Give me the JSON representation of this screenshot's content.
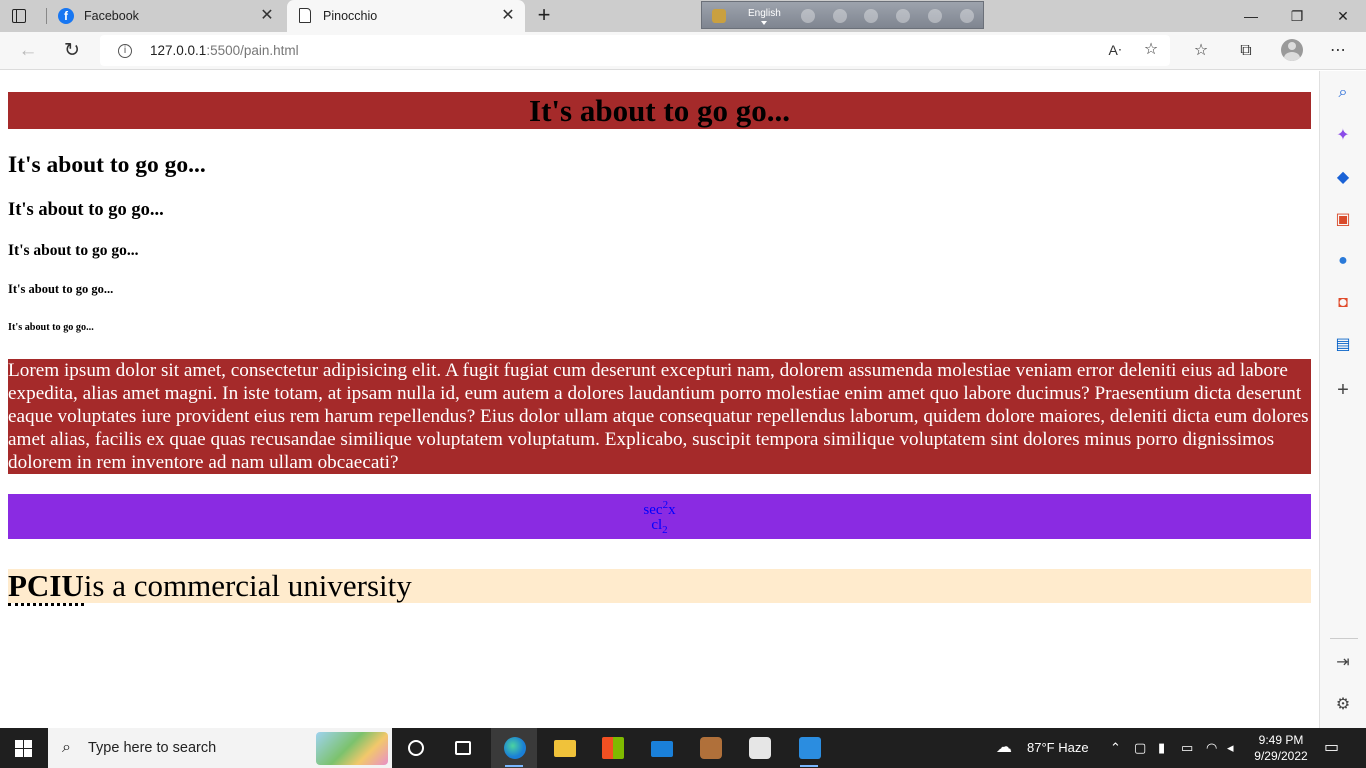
{
  "browser": {
    "tabs": [
      {
        "label": "Facebook",
        "icon": "facebook-icon"
      },
      {
        "label": "Pinocchio",
        "icon": "document-icon"
      }
    ],
    "ime_language": "English",
    "url_host": "127.0.0.1",
    "url_rest": ":5500/pain.html"
  },
  "page": {
    "h1": "It's about to go go...",
    "h2": "It's about to go go...",
    "h3": "It's about to go go...",
    "h4": "It's about to go go...",
    "h5": "It's about to go go...",
    "h6": "It's about to go go...",
    "paragraph": "Lorem ipsum dolor sit amet, consectetur adipisicing elit. A fugit fugiat cum deserunt excepturi nam, dolorem assumenda molestiae veniam error deleniti eius ad labore expedita, alias amet magni. In iste totam, at ipsam nulla id, eum autem a dolores laudantium porro molestiae enim amet quo labore ducimus? Praesentium dicta deserunt eaque voluptates iure provident eius rem harum repellendus? Eius dolor ullam atque consequatur repellendus laborum, quidem dolore maiores, deleniti dicta eum dolores amet alias, facilis ex quae quas recusandae similique voluptatem voluptatum. Explicabo, suscipit tempora similique voluptatem sint dolores minus porro dignissimos dolorem in rem inventore ad nam ullam obcaecati?",
    "math": {
      "line1_base": "sec",
      "line1_sup": "2",
      "line1_tail": "x",
      "line2_base": "cl",
      "line2_sub": "2"
    },
    "abbr": "PCIU",
    "abbr_tail": "is a commercial university"
  },
  "taskbar": {
    "search_placeholder": "Type here to search",
    "weather": "87°F  Haze",
    "time": "9:49 PM",
    "date": "9/29/2022"
  },
  "colors": {
    "heading_bg": "#a52a2a",
    "paragraph_bg": "#a52a2a",
    "math_bg": "#8a2be2",
    "abbr_bg": "#ffebcd"
  }
}
